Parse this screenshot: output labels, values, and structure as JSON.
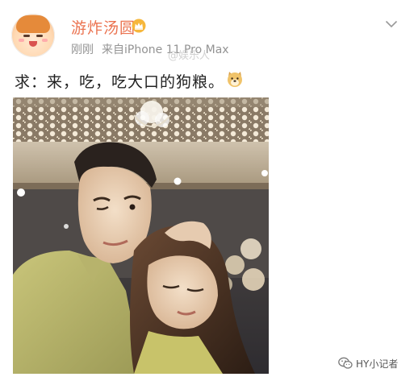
{
  "post": {
    "username": "游炸汤圆",
    "time": "刚刚",
    "source": "来自iPhone 11 Pro Max",
    "text": "求：来，吃，吃大口的狗粮。",
    "watermark": "@娱乐人"
  },
  "icons": {
    "verified_badge": "crown-icon",
    "menu": "chevron-down-icon",
    "emoji": "doge-emoji-icon",
    "wechat": "wechat-icon"
  },
  "footer": {
    "account": "HY小记者"
  },
  "colors": {
    "username": "#eb7350",
    "meta": "#939393",
    "text": "#222222"
  }
}
